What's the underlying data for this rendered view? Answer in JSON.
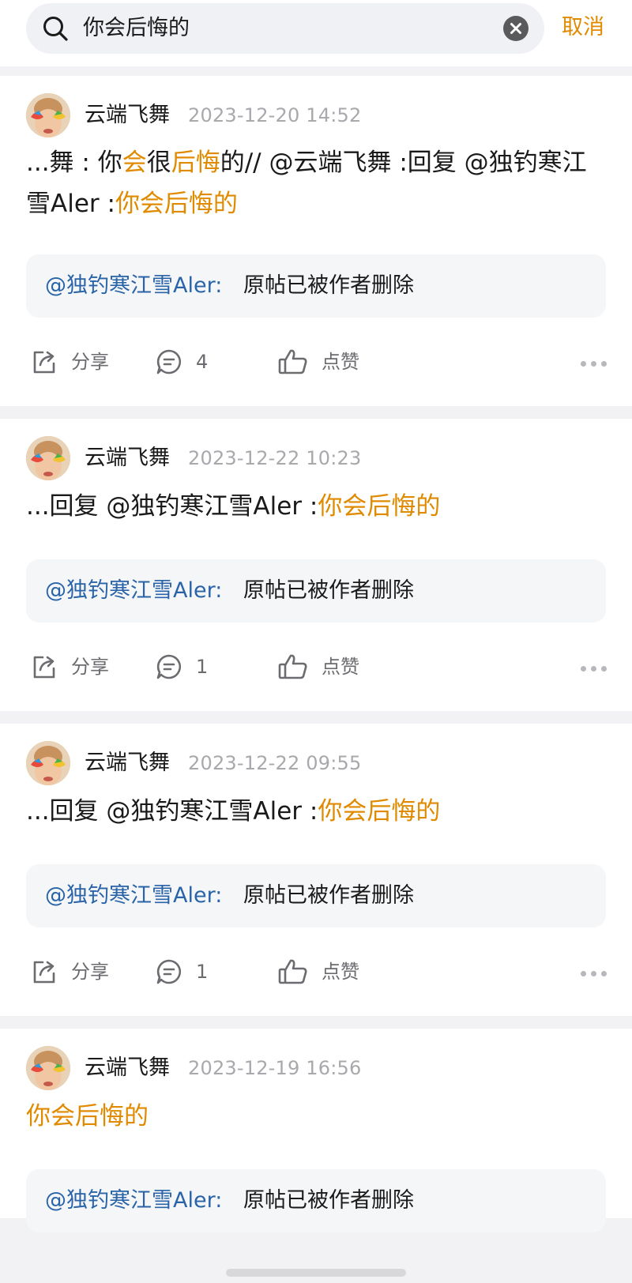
{
  "search": {
    "query": "你会后悔的",
    "cancel_label": "取消",
    "icon": "search-icon",
    "clear_icon": "clear-icon"
  },
  "posts": [
    {
      "author": "云端飞舞",
      "date": "2023-12-20 14:52",
      "content_segments": [
        {
          "text": "...舞 : 你",
          "highlight": false
        },
        {
          "text": "会",
          "highlight": true
        },
        {
          "text": "很",
          "highlight": false
        },
        {
          "text": "后悔",
          "highlight": true
        },
        {
          "text": "的// @云端飞舞 :回复 @独钓寒江雪Aler :",
          "highlight": false
        },
        {
          "text": "你会后悔的",
          "highlight": true
        }
      ],
      "quote_user": "@独钓寒江雪Aler:",
      "quote_text": "原帖已被作者删除",
      "share_label": "分享",
      "comment_count": "4",
      "like_label": "点赞"
    },
    {
      "author": "云端飞舞",
      "date": "2023-12-22 10:23",
      "content_segments": [
        {
          "text": "...回复 @独钓寒江雪Aler :",
          "highlight": false
        },
        {
          "text": "你会后悔的",
          "highlight": true
        }
      ],
      "quote_user": "@独钓寒江雪Aler:",
      "quote_text": "原帖已被作者删除",
      "share_label": "分享",
      "comment_count": "1",
      "like_label": "点赞"
    },
    {
      "author": "云端飞舞",
      "date": "2023-12-22 09:55",
      "content_segments": [
        {
          "text": "...回复 @独钓寒江雪Aler :",
          "highlight": false
        },
        {
          "text": "你会后悔的",
          "highlight": true
        }
      ],
      "quote_user": "@独钓寒江雪Aler:",
      "quote_text": "原帖已被作者删除",
      "share_label": "分享",
      "comment_count": "1",
      "like_label": "点赞"
    },
    {
      "author": "云端飞舞",
      "date": "2023-12-19 16:56",
      "content_segments": [
        {
          "text": "你会后悔的",
          "highlight": true
        }
      ],
      "quote_user": "@独钓寒江雪Aler:",
      "quote_text": "原帖已被作者删除"
    }
  ],
  "colors": {
    "accent": "#e08a00",
    "mention": "#2a64a8",
    "muted": "#a8a8ad",
    "background": "#f2f2f4"
  }
}
